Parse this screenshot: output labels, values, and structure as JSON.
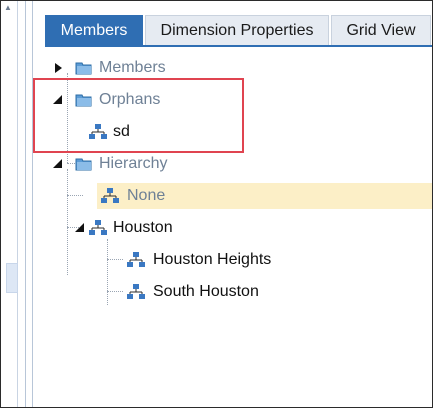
{
  "tabs": [
    {
      "label": "Members",
      "active": true
    },
    {
      "label": "Dimension Properties",
      "active": false
    },
    {
      "label": "Grid View",
      "active": false
    }
  ],
  "tree": {
    "members": {
      "label": "Members",
      "state": "collapsed",
      "icon": "folder-icon"
    },
    "orphans": {
      "label": "Orphans",
      "state": "expanded",
      "icon": "folder-icon",
      "children": [
        {
          "label": "sd",
          "icon": "hierarchy-node-icon"
        }
      ]
    },
    "hierarchy": {
      "label": "Hierarchy",
      "state": "expanded",
      "icon": "folder-icon",
      "children": [
        {
          "label": "None",
          "icon": "hierarchy-node-icon",
          "selected": true
        },
        {
          "label": "Houston",
          "icon": "hierarchy-node-icon",
          "state": "expanded",
          "children": [
            {
              "label": "Houston Heights",
              "icon": "hierarchy-node-icon"
            },
            {
              "label": "South Houston",
              "icon": "hierarchy-node-icon"
            }
          ]
        }
      ]
    }
  },
  "colors": {
    "tab_active": "#2f6eb3",
    "selection": "#fcefc7",
    "highlight_box": "#e04450",
    "muted_text": "#6f8196"
  }
}
